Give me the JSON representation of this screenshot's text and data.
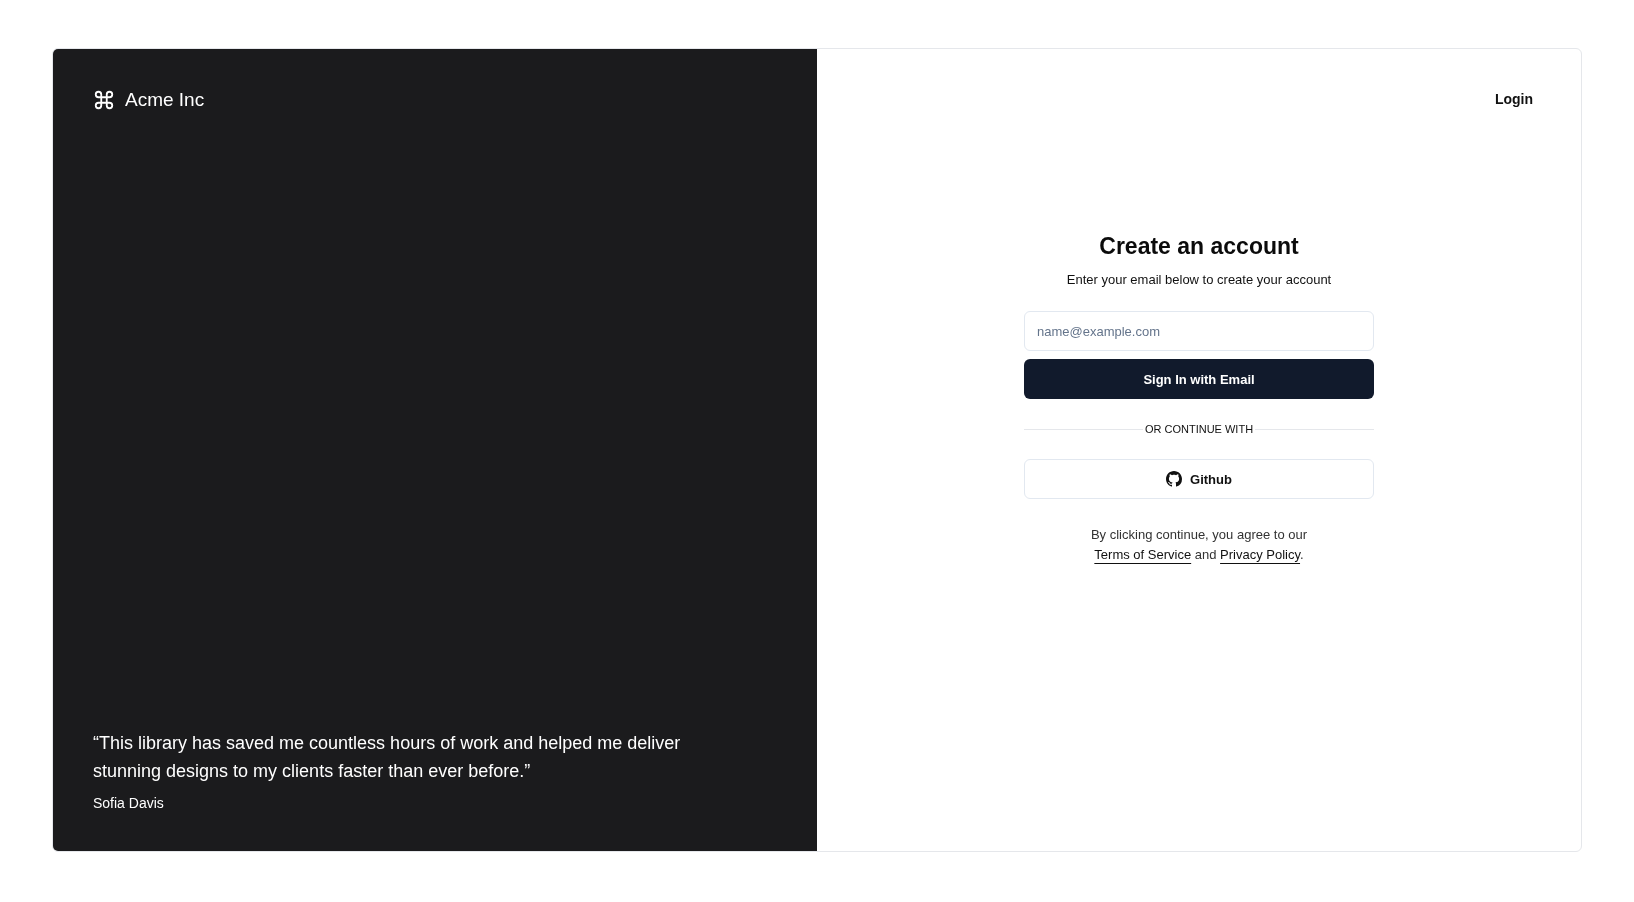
{
  "brand": {
    "name": "Acme Inc"
  },
  "top_link": "Login",
  "testimonial": {
    "quote": "“This library has saved me countless hours of work and helped me deliver stunning designs to my clients faster than ever before.”",
    "author": "Sofia Davis"
  },
  "form": {
    "title": "Create an account",
    "subtitle": "Enter your email below to create your account",
    "email": {
      "placeholder": "name@example.com"
    },
    "submit": "Sign In with Email",
    "divider": "OR CONTINUE WITH",
    "provider": "Github",
    "legal": {
      "prefix": "By clicking continue, you agree to our",
      "terms": "Terms of Service",
      "middle": "and",
      "privacy": "Privacy Policy",
      "suffix": "."
    }
  }
}
